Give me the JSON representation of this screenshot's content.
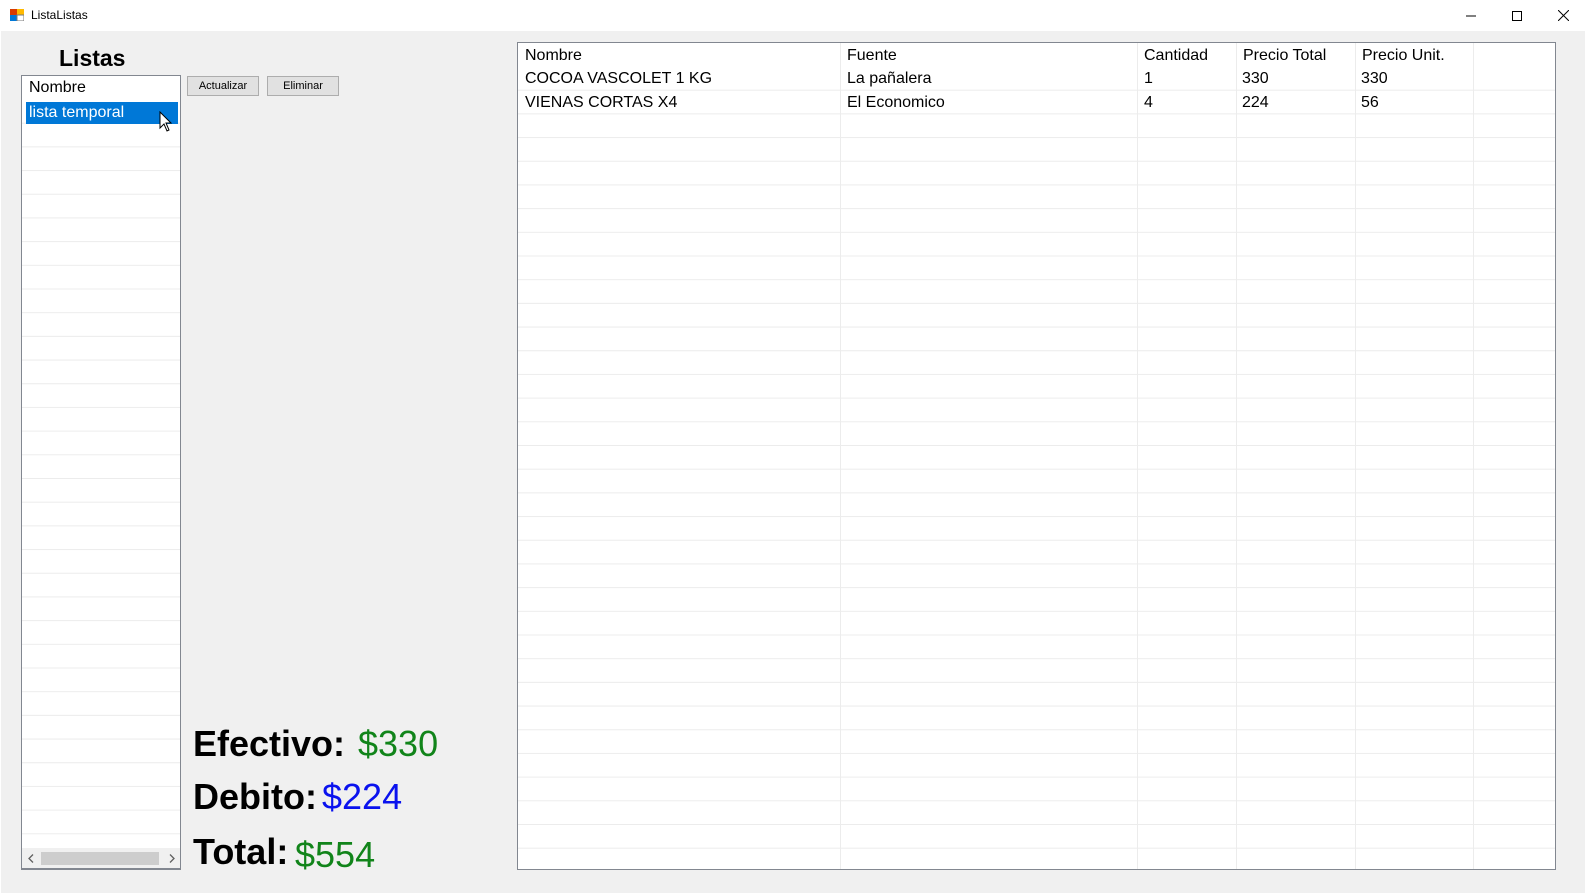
{
  "window": {
    "title": "ListaListas"
  },
  "heading": "Listas",
  "listbox": {
    "header": "Nombre",
    "items": [
      {
        "label": "lista temporal",
        "selected": true
      }
    ]
  },
  "buttons": {
    "actualizar": "Actualizar",
    "eliminar": "Eliminar"
  },
  "summary": {
    "efectivo_label": "Efectivo:",
    "efectivo_value": "$330",
    "debito_label": "Debito:",
    "debito_value": "$224",
    "total_label": "Total:",
    "total_value": "$554"
  },
  "table": {
    "columns": [
      "Nombre",
      "Fuente",
      "Cantidad",
      "Precio Total",
      "Precio Unit."
    ],
    "rows": [
      [
        "COCOA VASCOLET 1 KG",
        "La pañalera",
        "1",
        "330",
        "330"
      ],
      [
        "VIENAS CORTAS X4",
        "El Economico",
        "4",
        "224",
        "56"
      ]
    ]
  },
  "colors": {
    "selection": "#0078d7",
    "efectivo": "#11841a",
    "debito": "#0a12ee",
    "total": "#11841a"
  }
}
